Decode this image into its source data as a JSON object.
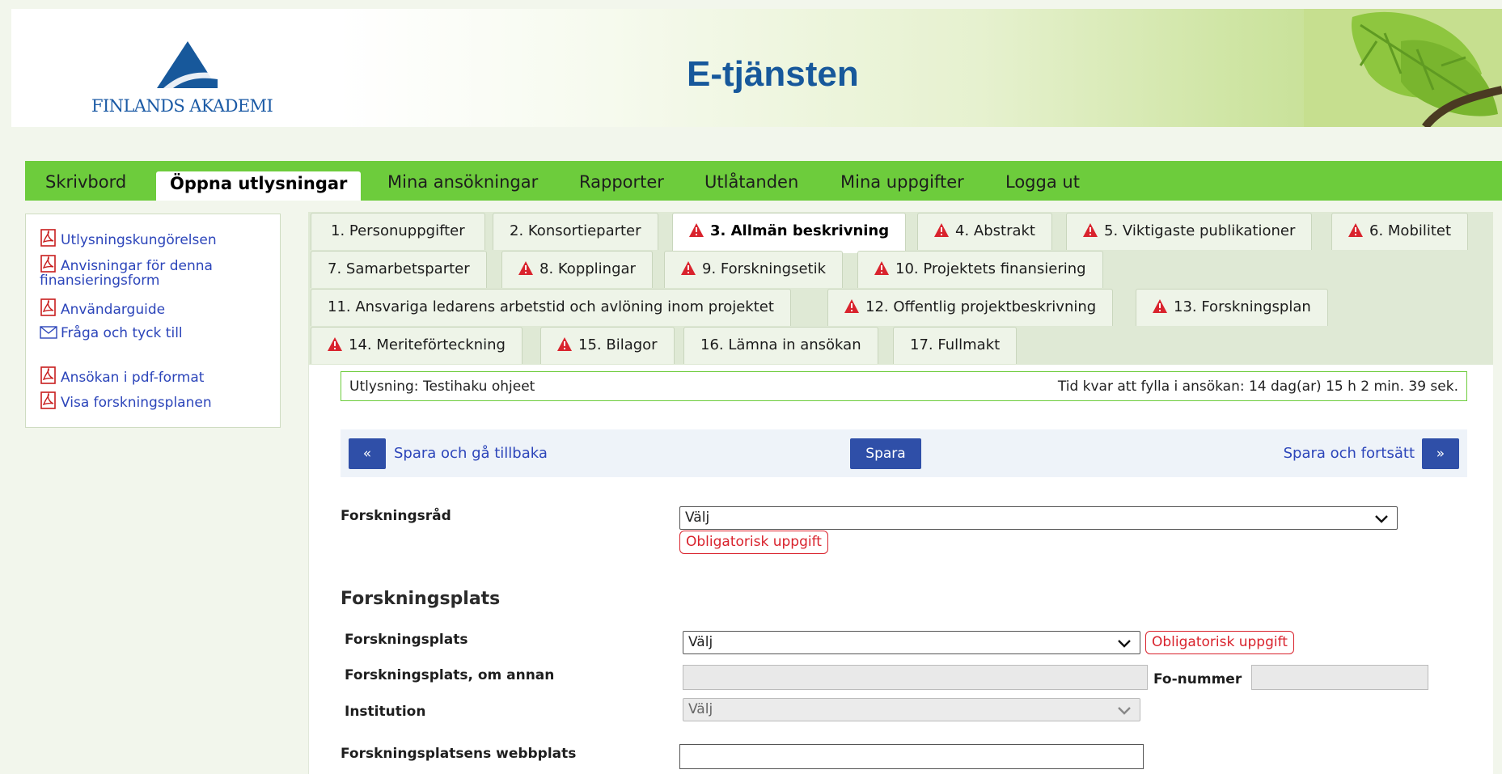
{
  "banner": {
    "org_name": "FINLANDS AKADEMI",
    "title": "E-tjänsten",
    "brand_color": "#17589b"
  },
  "main_nav": {
    "items": [
      "Skrivbord",
      "Öppna utlysningar",
      "Mina ansökningar",
      "Rapporter",
      "Utlåtanden",
      "Mina uppgifter",
      "Logga ut"
    ],
    "active_index": 1,
    "bar_color": "#6dcc3c"
  },
  "sidebar": {
    "links": [
      "Utlysningskungörelsen",
      "Anvisningar för denna",
      "finansieringsform",
      "Användarguide",
      "Fråga och tyck till",
      "Ansökan i pdf-format",
      "Visa forskningsplanen"
    ]
  },
  "tabs": [
    {
      "label": "1. Personuppgifter",
      "warning": false,
      "active": false
    },
    {
      "label": "2. Konsortieparter",
      "warning": false,
      "active": false
    },
    {
      "label": "3. Allmän beskrivning",
      "warning": true,
      "active": true
    },
    {
      "label": "4. Abstrakt",
      "warning": true,
      "active": false
    },
    {
      "label": "5. Viktigaste publikationer",
      "warning": true,
      "active": false
    },
    {
      "label": "6. Mobilitet",
      "warning": true,
      "active": false
    },
    {
      "label": "7. Samarbetsparter",
      "warning": false,
      "active": false
    },
    {
      "label": "8. Kopplingar",
      "warning": true,
      "active": false
    },
    {
      "label": "9. Forskningsetik",
      "warning": true,
      "active": false
    },
    {
      "label": "10. Projektets finansiering",
      "warning": true,
      "active": false
    },
    {
      "label": "11. Ansvariga ledarens arbetstid och avlöning inom projektet",
      "warning": false,
      "active": false
    },
    {
      "label": "12. Offentlig projektbeskrivning",
      "warning": true,
      "active": false
    },
    {
      "label": "13. Forskningsplan",
      "warning": true,
      "active": false
    },
    {
      "label": "14. Meriteförteckning",
      "warning": true,
      "active": false
    },
    {
      "label": "15. Bilagor",
      "warning": true,
      "active": false
    },
    {
      "label": "16. Lämna in ansökan",
      "warning": false,
      "active": false
    },
    {
      "label": "17. Fullmakt",
      "warning": false,
      "active": false
    }
  ],
  "info_bar": {
    "call": "Utlysning: Testihaku ohjeet",
    "time_left": "Tid kvar att fylla i ansökan: 14 dag(ar) 15 h 2 min. 39 sek."
  },
  "actions": {
    "back_symbol": "«",
    "back_label": "Spara och gå tillbaka",
    "save_label": "Spara",
    "next_label": "Spara och fortsätt",
    "next_symbol": "»"
  },
  "form": {
    "council_label": "Forskningsråd",
    "council_value": "Välj",
    "required_text": "Obligatorisk uppgift",
    "section_title": "Forskningsplats",
    "place_label": "Forskningsplats",
    "place_value": "Välj",
    "place_other_label": "Forskningsplats, om annan",
    "fo_number_label": "Fo-nummer",
    "institution_label": "Institution",
    "institution_value": "Välj",
    "website_label": "Forskningsplatsens webbplats"
  },
  "colors": {
    "warning_red": "#d9232d",
    "link_blue": "#2c45ba",
    "button_blue": "#2f4fa8"
  }
}
